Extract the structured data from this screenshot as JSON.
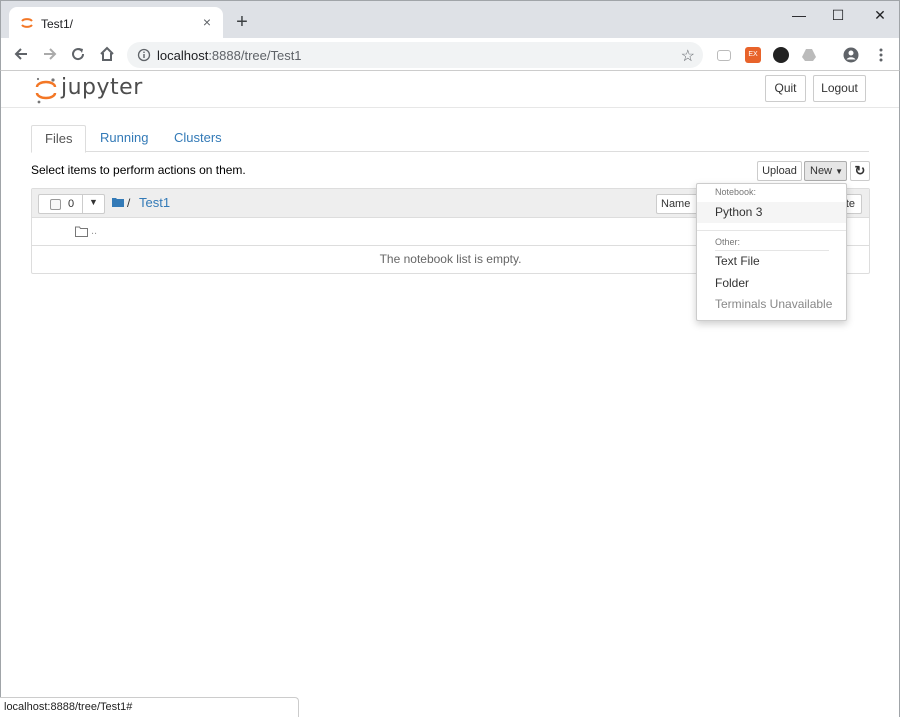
{
  "browser": {
    "tab_title": "Test1/",
    "tab_close": "×",
    "new_tab": "+",
    "minimize": "—",
    "maximize": "☐",
    "close": "✕",
    "url_host": "localhost",
    "url_rest": ":8888/tree/Test1",
    "status_url": "localhost:8888/tree/Test1#"
  },
  "jupyter": {
    "logo_text": "jupyter",
    "quit_label": "Quit",
    "logout_label": "Logout"
  },
  "tabs": [
    {
      "label": "Files"
    },
    {
      "label": "Running"
    },
    {
      "label": "Clusters"
    }
  ],
  "toolbar": {
    "select_text": "Select items to perform actions on them.",
    "upload_label": "Upload",
    "new_label": "New",
    "refresh_icon": "↻"
  },
  "list": {
    "selected_count": "0",
    "breadcrumb_sep": "/",
    "breadcrumb_folder": "Test1",
    "sort_name_label": "Name",
    "sort_last_fragment": "te",
    "parent_dir": "..",
    "empty_message": "The notebook list is empty."
  },
  "new_menu": {
    "notebook_header": "Notebook:",
    "python3": "Python 3",
    "other_header": "Other:",
    "text_file": "Text File",
    "folder": "Folder",
    "terminals": "Terminals Unavailable"
  },
  "colors": {
    "link": "#337ab7",
    "jupyter_orange": "#f37726"
  }
}
